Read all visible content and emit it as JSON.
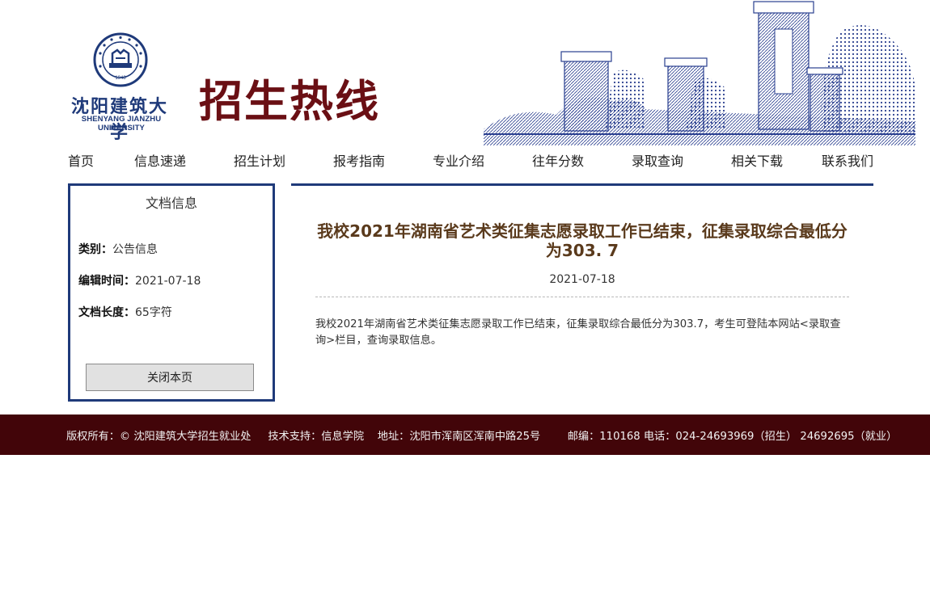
{
  "header": {
    "logo_cn": "沈阳建筑大学",
    "logo_en": "SHENYANG JIANZHU UNIVERSITY",
    "seal_year": "1948",
    "hotline_title": "招生热线",
    "colors": {
      "brand_blue": "#1f3a7a",
      "title_red": "#6a0f14"
    }
  },
  "nav": {
    "items": [
      "首页",
      "信息速递",
      "招生计划",
      "报考指南",
      "专业介绍",
      "往年分数",
      "录取查询",
      "相关下载",
      "联系我们"
    ]
  },
  "sidebar": {
    "title": "文档信息",
    "category_label": "类别：",
    "category_value": "公告信息",
    "edit_time_label": "编辑时间：",
    "edit_time_value": "2021-07-18",
    "length_label": "文档长度：",
    "length_value": "65字符",
    "close_button": "关闭本页"
  },
  "article": {
    "title": "我校2021年湖南省艺术类征集志愿录取工作已结束，征集录取综合最低分为303. 7",
    "date": "2021-07-18",
    "body": "我校2021年湖南省艺术类征集志愿录取工作已结束，征集录取综合最低分为303.7，考生可登陆本网站<录取查询>栏目，查询录取信息。",
    "title_color": "#5a3a1c"
  },
  "footer": {
    "text": "版权所有：© 沈阳建筑大学招生就业处     技术支持：信息学院    地址：沈阳市浑南区浑南中路25号        邮编：110168 电话：024-24693969（招生） 24692695（就业）",
    "bg_color": "#420509"
  }
}
